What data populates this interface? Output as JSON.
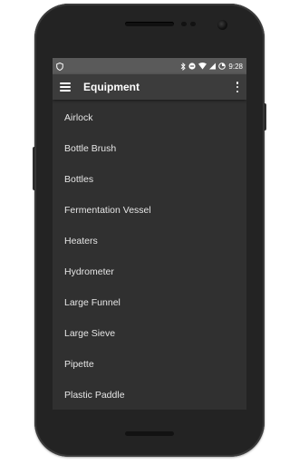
{
  "statusbar": {
    "time": "9:28"
  },
  "toolbar": {
    "title": "Equipment"
  },
  "equipment": [
    "Airlock",
    "Bottle Brush",
    "Bottles",
    "Fermentation Vessel",
    "Heaters",
    "Hydrometer",
    "Large Funnel",
    "Large Sieve",
    "Pipette",
    "Plastic Paddle"
  ],
  "colors": {
    "statusbar": "#5a5a5a",
    "toolbar": "#3c3c3c",
    "background": "#303030",
    "text": "#e6e6e6"
  }
}
